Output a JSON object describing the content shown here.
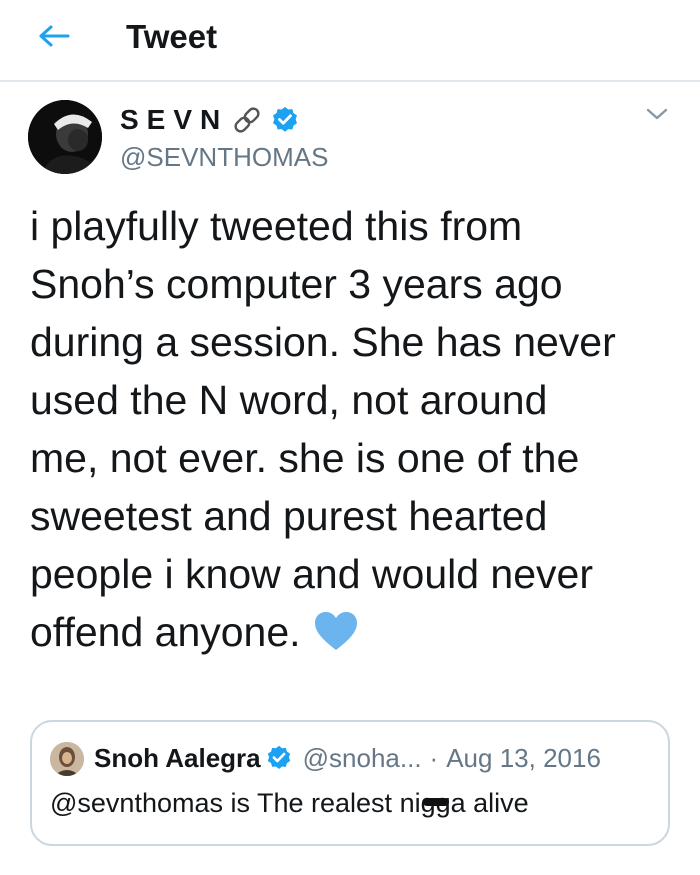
{
  "header": {
    "title": "Tweet",
    "back_icon": "arrow-left-icon",
    "accent_color": "#1da1f2"
  },
  "tweet": {
    "display_name": "SEVN",
    "handle": "@SEVNTHOMAS",
    "name_icons": [
      "link-icon",
      "verified-icon"
    ],
    "menu_icon": "chevron-down-icon",
    "text_lines": [
      "i playfully tweeted this from",
      "Snoh’s computer 3 years ago",
      "during a session. She has never",
      "used the N word, not around",
      "me, not ever. she is one of the",
      "sweetest and purest hearted",
      "people i know and would never",
      "offend anyone."
    ],
    "emoji": "blue-heart-icon",
    "emoji_color": "#6cb4ee"
  },
  "quoted_tweet": {
    "display_name": "Snoh Aalegra",
    "handle": "@snoha...",
    "separator": "·",
    "date": "Aug 13, 2016",
    "text_before": "@sevnthomas is The realest ni",
    "text_censored": "gg",
    "text_after": "a alive",
    "verified_color": "#1da1f2"
  }
}
